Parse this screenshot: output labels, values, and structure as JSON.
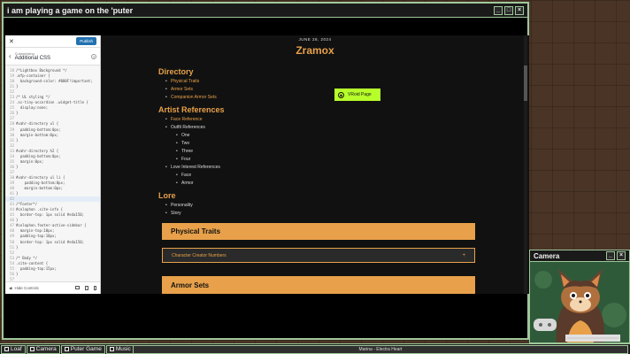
{
  "main_window": {
    "title": "i am playing a game on the 'puter"
  },
  "customizer": {
    "close": "✕",
    "publish_label": "Publish",
    "breadcrumb": "Customizing",
    "panel_title": "Additional CSS",
    "help": "?",
    "code_lines": [
      {
        "n": "18",
        "t": "/*Lightbox Background */"
      },
      {
        "n": "19",
        "t": ".mfp-container {"
      },
      {
        "n": "20",
        "t": "  background-color: #000F!important;"
      },
      {
        "n": "21",
        "t": "}"
      },
      {
        "n": "22",
        "t": ""
      },
      {
        "n": "23",
        "t": "/* UL styling */"
      },
      {
        "n": "24",
        "t": ".sc-tiny-accordion .widget-title {"
      },
      {
        "n": "25",
        "t": "  display:none;"
      },
      {
        "n": "26",
        "t": "}"
      },
      {
        "n": "27",
        "t": ""
      },
      {
        "n": "28",
        "t": "#vahr-directory ul {"
      },
      {
        "n": "29",
        "t": "  padding-bottom:0px;"
      },
      {
        "n": "30",
        "t": "  margin-bottom:0px;"
      },
      {
        "n": "31",
        "t": "}"
      },
      {
        "n": "32",
        "t": ""
      },
      {
        "n": "33",
        "t": "#vahr-directory h2 {"
      },
      {
        "n": "34",
        "t": "  padding-bottom:0px;"
      },
      {
        "n": "35",
        "t": "  margin:0px;"
      },
      {
        "n": "36",
        "t": "}"
      },
      {
        "n": "37",
        "t": ""
      },
      {
        "n": "38",
        "t": "#vahr-directory ul li {"
      },
      {
        "n": "39",
        "t": "    padding-bottom:0px;"
      },
      {
        "n": "40",
        "t": "    margin-bottom:0px;"
      },
      {
        "n": "41",
        "t": "}"
      },
      {
        "n": "42",
        "t": ""
      },
      {
        "n": "43",
        "t": "/*Footer*/"
      },
      {
        "n": "44",
        "t": "#colophon .site-info {"
      },
      {
        "n": "45",
        "t": "  border-top: 1px solid #e4a150;"
      },
      {
        "n": "46",
        "t": "}"
      },
      {
        "n": "47",
        "t": "#colophon.footer-active-sidebar {"
      },
      {
        "n": "48",
        "t": "  margin-top:10px;"
      },
      {
        "n": "49",
        "t": "  padding-top:10px;"
      },
      {
        "n": "50",
        "t": "  border-top: 1px solid #e4a150;"
      },
      {
        "n": "51",
        "t": "}"
      },
      {
        "n": "52",
        "t": ""
      },
      {
        "n": "53",
        "t": "/* Body */"
      },
      {
        "n": "54",
        "t": ".site-content {"
      },
      {
        "n": "55",
        "t": "  padding-top:15px;"
      },
      {
        "n": "56",
        "t": "}"
      },
      {
        "n": "57",
        "t": ""
      },
      {
        "n": "58",
        "t": "#games-sections li {"
      }
    ],
    "hide_controls": "Hide Controls"
  },
  "site": {
    "date": "JUNE 28, 2024",
    "title": "Zramox",
    "directory_heading": "Directory",
    "directory_items": [
      "Physical Traits",
      "Armor Sets",
      "Companion Armor Sets"
    ],
    "vtuber_button": "VRoid Page",
    "artist_heading": "Artist References",
    "face_ref": "Face Reference",
    "outfit_refs": "Outfit References",
    "outfit_subitems": [
      "One",
      "Two",
      "Three",
      "Four"
    ],
    "love_refs": "Love Interest References",
    "love_subitems": [
      "Face",
      "Armor"
    ],
    "lore_heading": "Lore",
    "lore_items": [
      "Personality",
      "Story"
    ],
    "accordion_physical": "Physical Traits",
    "accordion_character": "Character Creator Numbers",
    "accordion_plus": "+",
    "accordion_armor": "Armor Sets"
  },
  "camera_window": {
    "title": "Camera"
  },
  "taskbar": {
    "items": [
      "Loaf",
      "Camera",
      "Puter Game",
      "Music"
    ],
    "now_playing": "Marina - Electra Heart"
  },
  "colors": {
    "accent": "#e8a14a",
    "window_border": "#9fc79a",
    "vroid_button": "#b7ff2a",
    "desktop": "#4a3426"
  }
}
